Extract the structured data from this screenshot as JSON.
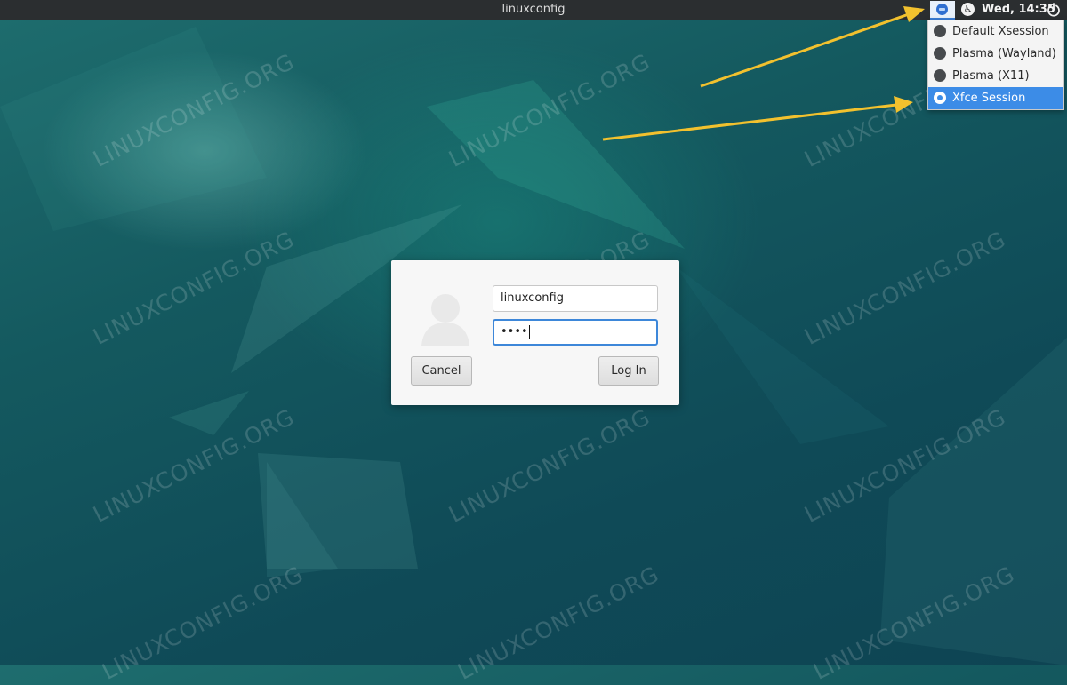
{
  "topbar": {
    "hostname": "linuxconfig",
    "clock": "Wed, 14:35",
    "icons": [
      "session-icon",
      "accessibility-icon",
      "power-icon"
    ]
  },
  "session_menu": {
    "items": [
      {
        "label": "Default Xsession",
        "selected": false
      },
      {
        "label": "Plasma (Wayland)",
        "selected": false
      },
      {
        "label": "Plasma (X11)",
        "selected": false
      },
      {
        "label": "Xfce Session",
        "selected": true
      }
    ]
  },
  "login": {
    "username": "linuxconfig",
    "password_mask": "••••",
    "cancel_label": "Cancel",
    "login_label": "Log In"
  },
  "watermark": "LINUXCONFIG.ORG",
  "colors": {
    "accent": "#3c8ce7",
    "arrow": "#f2c12e",
    "panel": "#2b2e30"
  }
}
